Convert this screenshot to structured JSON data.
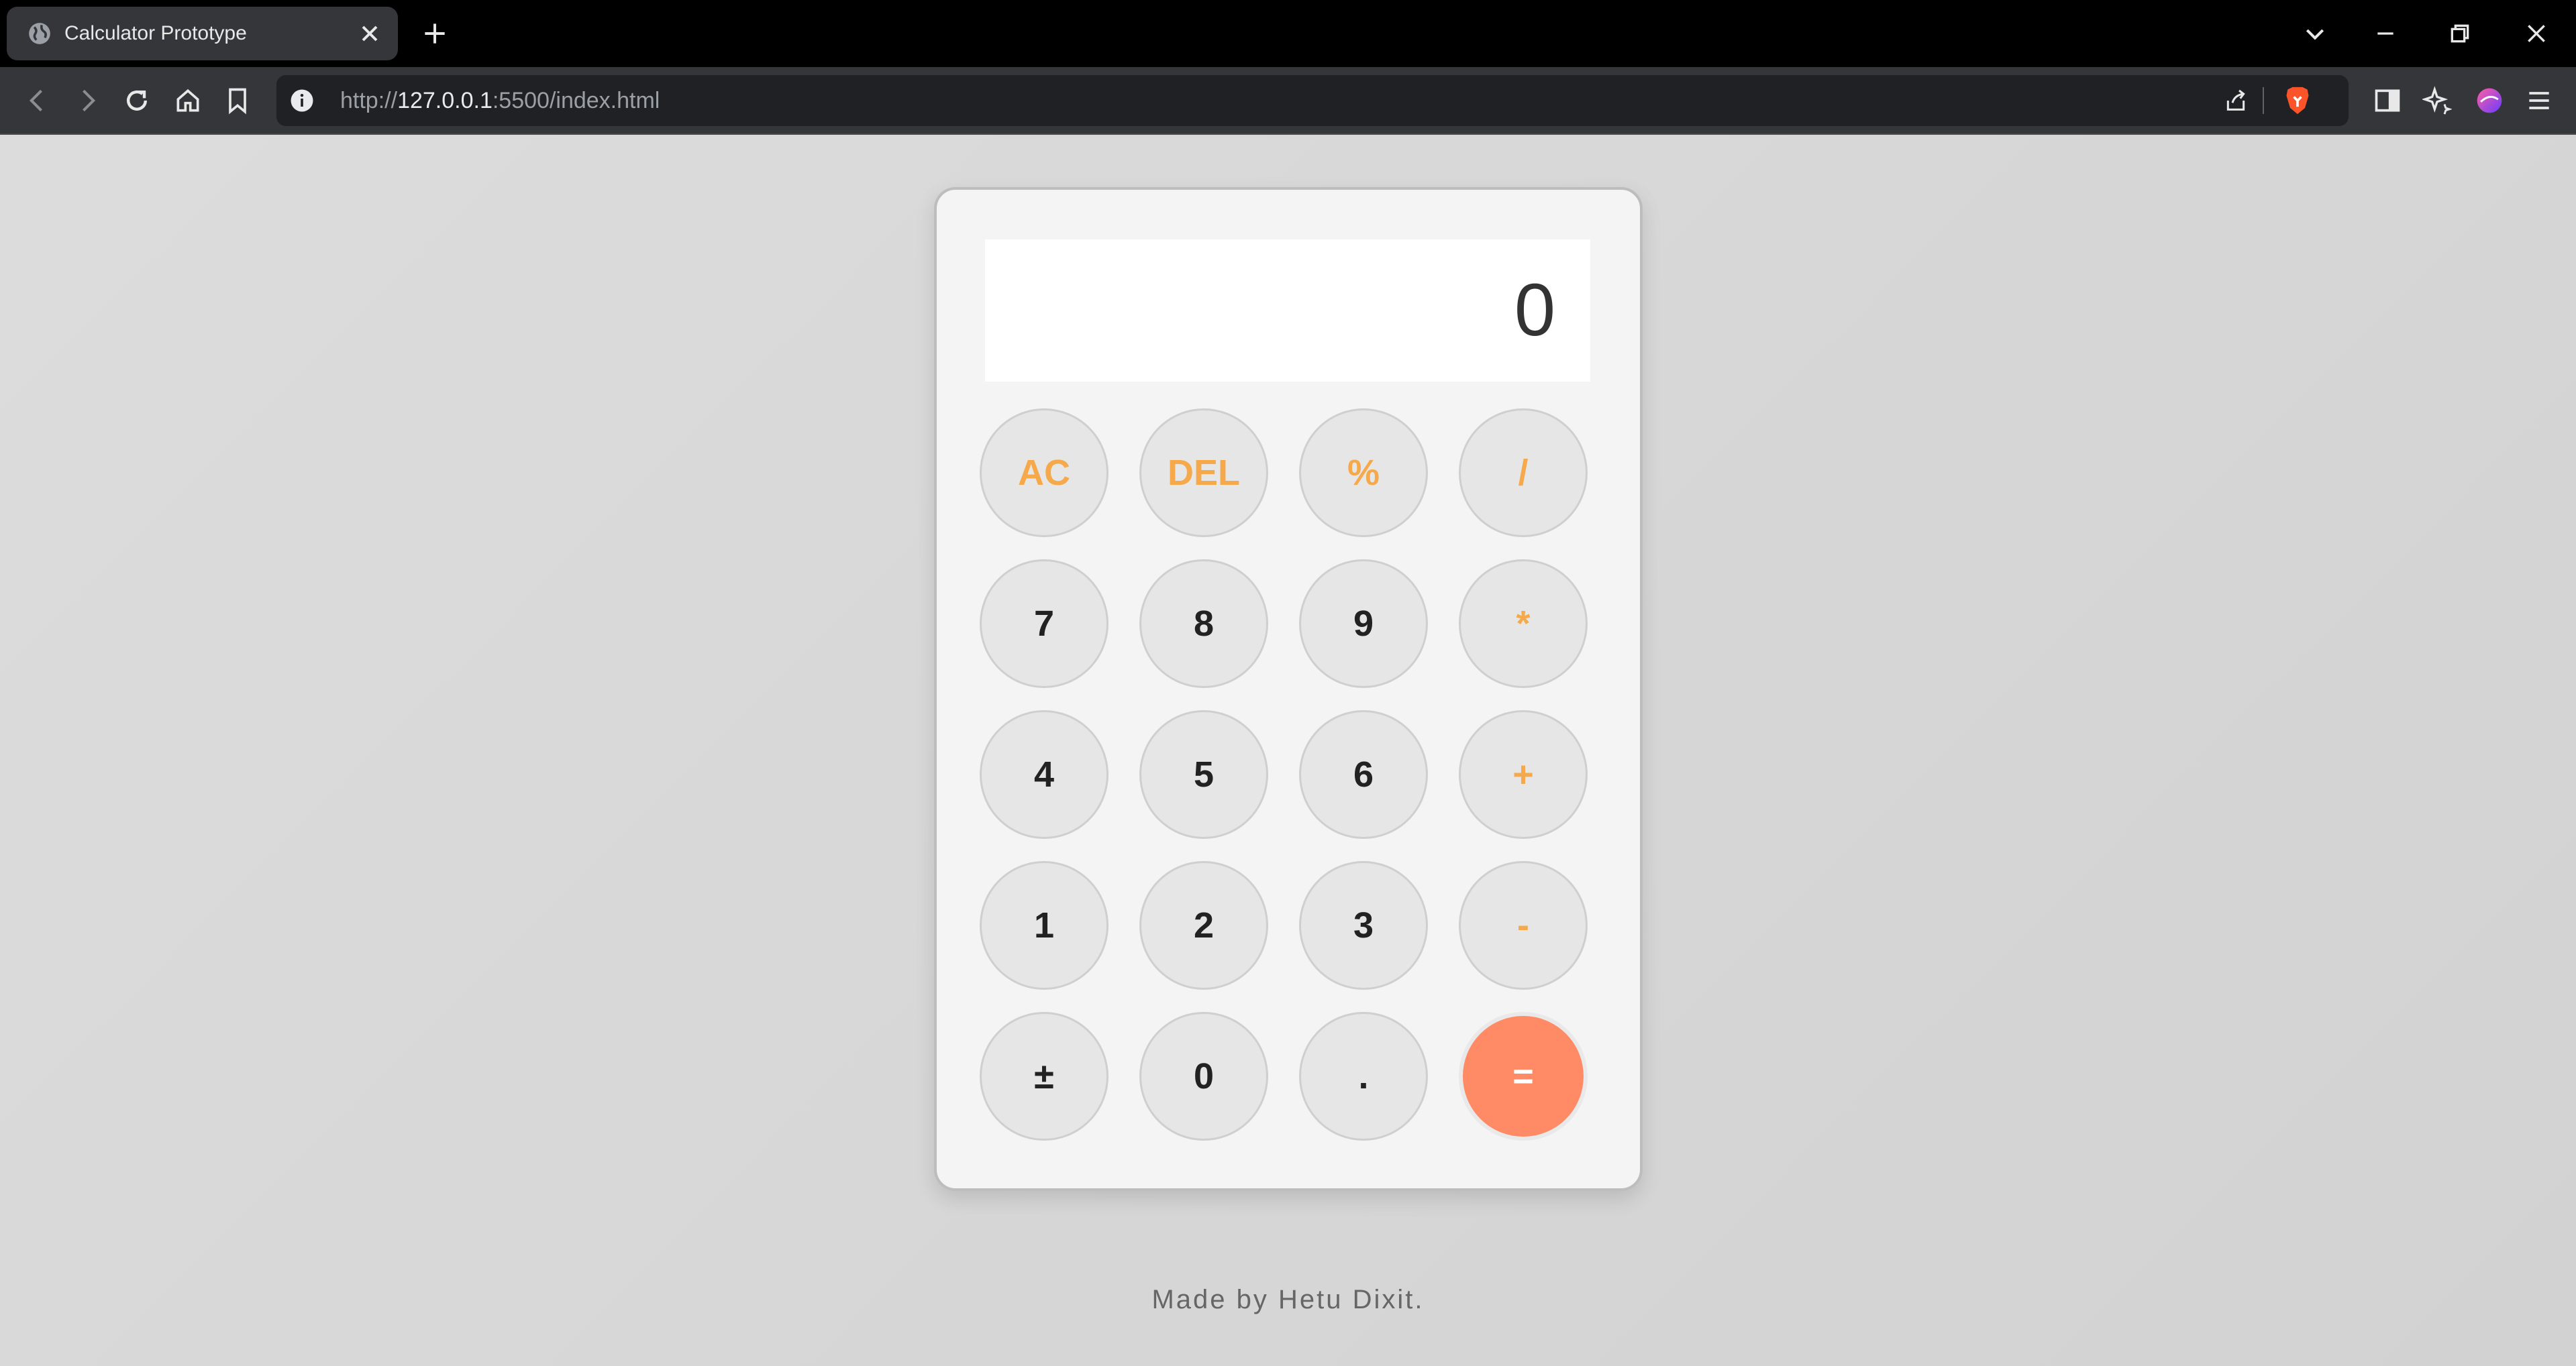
{
  "browser": {
    "tab_title": "Calculator Prototype",
    "url_scheme": "http://",
    "url_host": "127.0.0.1",
    "url_rest": ":5500/index.html"
  },
  "calculator": {
    "display_value": "0",
    "keys": [
      {
        "label": "AC",
        "kind": "op"
      },
      {
        "label": "DEL",
        "kind": "op"
      },
      {
        "label": "%",
        "kind": "op"
      },
      {
        "label": "/",
        "kind": "op"
      },
      {
        "label": "7",
        "kind": "num"
      },
      {
        "label": "8",
        "kind": "num"
      },
      {
        "label": "9",
        "kind": "num"
      },
      {
        "label": "*",
        "kind": "op"
      },
      {
        "label": "4",
        "kind": "num"
      },
      {
        "label": "5",
        "kind": "num"
      },
      {
        "label": "6",
        "kind": "num"
      },
      {
        "label": "+",
        "kind": "op"
      },
      {
        "label": "1",
        "kind": "num"
      },
      {
        "label": "2",
        "kind": "num"
      },
      {
        "label": "3",
        "kind": "num"
      },
      {
        "label": "-",
        "kind": "op"
      },
      {
        "label": "±",
        "kind": "num"
      },
      {
        "label": "0",
        "kind": "num"
      },
      {
        "label": ".",
        "kind": "num"
      },
      {
        "label": "=",
        "kind": "eq"
      }
    ]
  },
  "footer": {
    "text": "Made by Hetu Dixit."
  },
  "colors": {
    "operator": "#f5a94b",
    "equals_bg": "#ff8a66",
    "key_bg": "#e6e6e6",
    "page_bg": "#d8d8d8"
  }
}
